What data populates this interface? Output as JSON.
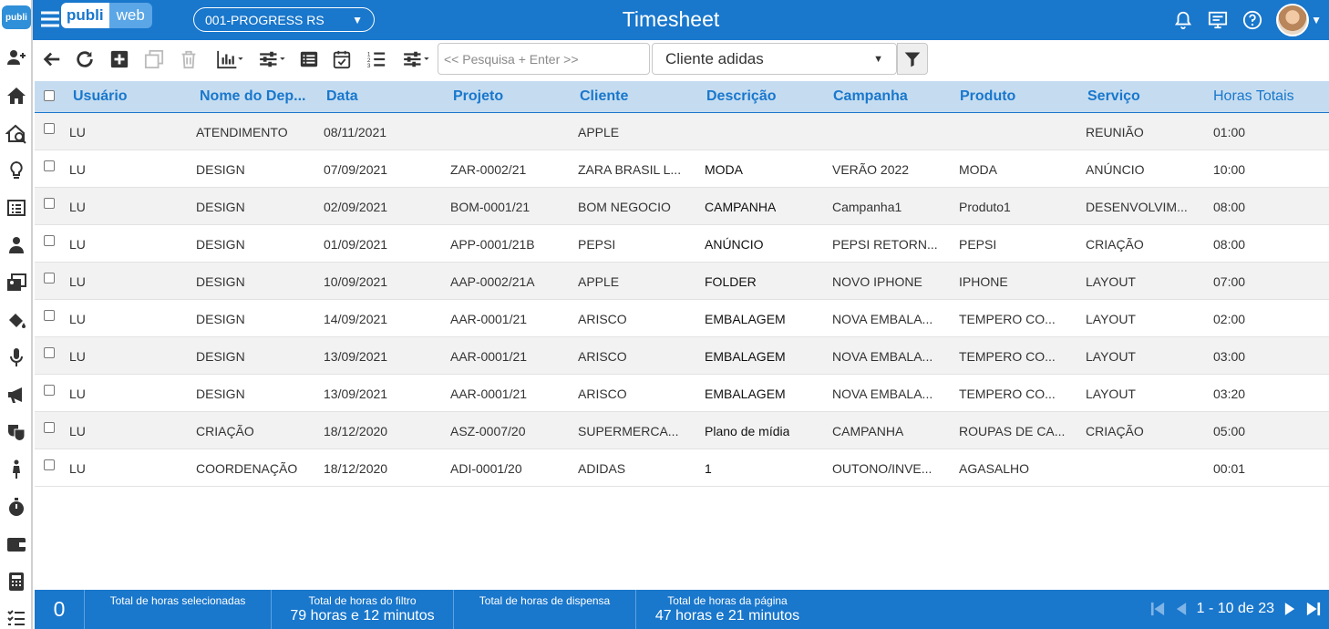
{
  "app": {
    "logo_small": "publi",
    "brand_left": "publi",
    "brand_right": "web",
    "title": "Timesheet"
  },
  "company_select": {
    "value": "001-PROGRESS RS"
  },
  "toolbar": {
    "search_placeholder": "<< Pesquisa + Enter >>",
    "client_filter": "Cliente adidas"
  },
  "table": {
    "headers": [
      "Usuário",
      "Nome do Dep...",
      "Data",
      "Projeto",
      "Cliente",
      "Descrição",
      "Campanha",
      "Produto",
      "Serviço",
      "Horas Totais"
    ],
    "rows": [
      [
        "LU",
        "ATENDIMENTO",
        "08/11/2021",
        "",
        "APPLE",
        "",
        "",
        "",
        "REUNIÃO",
        "01:00"
      ],
      [
        "LU",
        "DESIGN",
        "07/09/2021",
        "ZAR-0002/21",
        "ZARA BRASIL L...",
        "MODA",
        "VERÃO 2022",
        "MODA",
        "ANÚNCIO",
        "10:00"
      ],
      [
        "LU",
        "DESIGN",
        "02/09/2021",
        "BOM-0001/21",
        "BOM NEGOCIO",
        "CAMPANHA",
        "Campanha1",
        "Produto1",
        "DESENVOLVIM...",
        "08:00"
      ],
      [
        "LU",
        "DESIGN",
        "01/09/2021",
        "APP-0001/21B",
        "PEPSI",
        "ANÚNCIO",
        "PEPSI RETORN...",
        "PEPSI",
        "CRIAÇÃO",
        "08:00"
      ],
      [
        "LU",
        "DESIGN",
        "10/09/2021",
        "AAP-0002/21A",
        "APPLE",
        "FOLDER",
        "NOVO IPHONE",
        "IPHONE",
        "LAYOUT",
        "07:00"
      ],
      [
        "LU",
        "DESIGN",
        "14/09/2021",
        "AAR-0001/21",
        "ARISCO",
        "EMBALAGEM",
        "NOVA EMBALA...",
        "TEMPERO CO...",
        "LAYOUT",
        "02:00"
      ],
      [
        "LU",
        "DESIGN",
        "13/09/2021",
        "AAR-0001/21",
        "ARISCO",
        "EMBALAGEM",
        "NOVA EMBALA...",
        "TEMPERO CO...",
        "LAYOUT",
        "03:00"
      ],
      [
        "LU",
        "DESIGN",
        "13/09/2021",
        "AAR-0001/21",
        "ARISCO",
        "EMBALAGEM",
        "NOVA EMBALA...",
        "TEMPERO CO...",
        "LAYOUT",
        "03:20"
      ],
      [
        "LU",
        "CRIAÇÃO",
        "18/12/2020",
        "ASZ-0007/20",
        "SUPERMERCA...",
        "Plano de mídia",
        "CAMPANHA",
        "ROUPAS DE CA...",
        "CRIAÇÃO",
        "05:00"
      ],
      [
        "LU",
        "COORDENAÇÃO",
        "18/12/2020",
        "ADI-0001/20",
        "ADIDAS",
        "1",
        "OUTONO/INVE...",
        "AGASALHO",
        "",
        "00:01"
      ]
    ]
  },
  "footer": {
    "selected_count": "0",
    "selected_label": "Total de horas selecionadas",
    "filter_label": "Total de horas do filtro",
    "filter_value": "79 horas e 12 minutos",
    "dispensa_label": "Total de horas de dispensa",
    "page_label": "Total de horas da página",
    "page_value": "47 horas e 21 minutos",
    "pager_text": "1 - 10 de 23"
  },
  "colors": {
    "primary": "#1977cc",
    "header_bg": "#c5dcf0"
  },
  "icons": [
    "hamburger-icon",
    "bell-icon",
    "monitor-icon",
    "help-icon",
    "back-icon",
    "refresh-icon",
    "add-icon",
    "copy-icon",
    "trash-icon",
    "chart-icon",
    "sliders-icon",
    "list-icon",
    "calendar-check-icon",
    "ordered-list-icon",
    "filter-icon"
  ]
}
